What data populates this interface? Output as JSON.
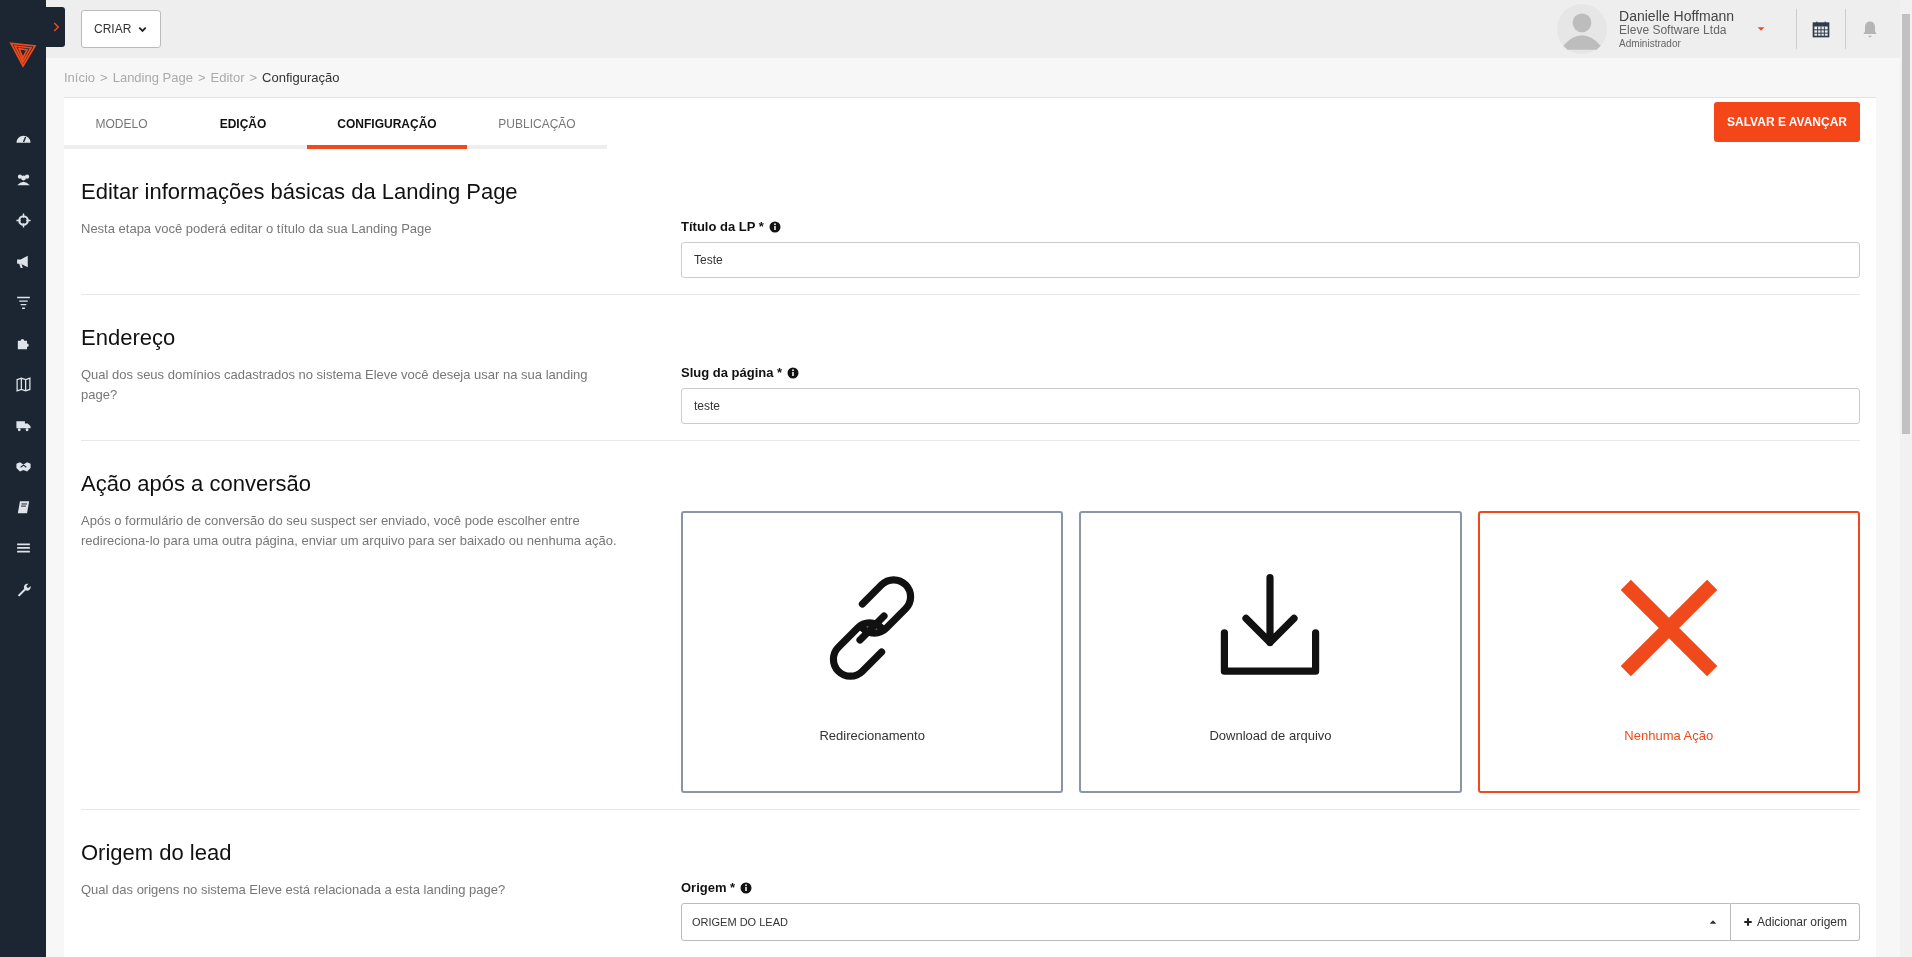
{
  "header": {
    "create_button": "CRIAR",
    "user": {
      "name": "Danielle Hoffmann",
      "company": "Eleve Software Ltda",
      "role": "Administrador"
    }
  },
  "breadcrumb": [
    {
      "label": "Início",
      "current": false
    },
    {
      "label": "Landing Page",
      "current": false
    },
    {
      "label": "Editor",
      "current": false
    },
    {
      "label": "Configuração",
      "current": true
    }
  ],
  "breadcrumb_separator": ">",
  "tabs": [
    {
      "label": "MODELO",
      "selected": false,
      "done": false
    },
    {
      "label": "EDIÇÃO",
      "selected": false,
      "done": true
    },
    {
      "label": "CONFIGURAÇÃO",
      "selected": true,
      "done": true
    },
    {
      "label": "PUBLICAÇÃO",
      "selected": false,
      "done": false
    }
  ],
  "save_button": "SALVAR E AVANÇAR",
  "sections": [
    {
      "kind": "input",
      "title": "Editar informações básicas da Landing Page",
      "description": "Nesta etapa você poderá editar o título da sua Landing Page",
      "field": {
        "label": "Título da LP *",
        "value": "Teste"
      }
    },
    {
      "kind": "input",
      "title": "Endereço",
      "description": "Qual dos seus domínios cadastrados no sistema Eleve você deseja usar na sua landing page?",
      "field": {
        "label": "Slug da página *",
        "value": "teste"
      }
    },
    {
      "kind": "cards",
      "title": "Ação após a conversão",
      "description": "Após o formulário de conversão do seu suspect ser enviado, você pode escolher entre redireciona-lo para uma outra página, enviar um arquivo para ser baixado ou nenhuma ação.",
      "options": [
        {
          "kind": "link",
          "label": "Redirecionamento",
          "selected": false
        },
        {
          "kind": "download",
          "label": "Download de arquivo",
          "selected": false
        },
        {
          "kind": "none",
          "label": "Nenhuma Ação",
          "selected": true
        }
      ]
    },
    {
      "kind": "select",
      "title": "Origem do lead",
      "description": "Qual das origens no sistema Eleve está relacionada a esta landing page?",
      "field": {
        "label": "Origem *",
        "value": "ORIGEM DO LEAD",
        "add_button": "Adicionar origem"
      }
    }
  ]
}
